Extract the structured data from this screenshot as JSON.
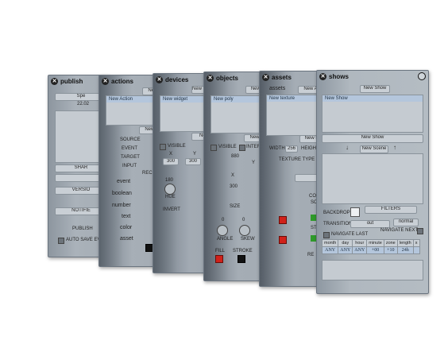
{
  "colors": {
    "accent_red": "#d0211a",
    "accent_green": "#2e9a2a",
    "panel": "#a9b1b9",
    "selection": "#b4c6dc"
  },
  "publish": {
    "title": "publish",
    "top_button": "Spe",
    "field": "22.02",
    "row1": "SHAR",
    "row2": "VERSIO",
    "row3": "NOTIFIE",
    "row4": "PUBLISH",
    "auto_save": "AUTO SAVE EV"
  },
  "actions": {
    "title": "actions",
    "new_button": "New A",
    "selected": "New Action",
    "new_button2": "New A",
    "fields": [
      "SOURCE",
      "EVENT",
      "TARGET",
      "INPUT"
    ],
    "receive": "RECEI",
    "types": [
      "event",
      "boolean",
      "number",
      "text",
      "color",
      "asset"
    ]
  },
  "devices": {
    "title": "devices",
    "new_button": "New Widget",
    "selected": "New widget",
    "new_button2": "New",
    "visible": "VISIBLE",
    "x": "X",
    "y": "Y",
    "val1": "300",
    "val2": "300",
    "hue_val": "180",
    "hue": "HUE",
    "invert": "INVERT"
  },
  "objects": {
    "title": "objects",
    "new_button": "New O",
    "selected": "New poly",
    "new_button2": "New p",
    "visible": "VISIBLE",
    "interact": "INTERA",
    "x_val": "880",
    "y_label": "Y",
    "x": "X",
    "val": "300",
    "size": "SIZE",
    "val0": "0",
    "val1": "0",
    "angle": "ANGLE",
    "skew": "SKEW",
    "fill": "FILL",
    "stroke": "STROKE"
  },
  "assets": {
    "title": "assets",
    "sub": "assets",
    "new_button": "New A",
    "selected": "New texture",
    "new_button2": "New te",
    "width": "WIDTH",
    "width_val": "256",
    "height": "HEIGHT",
    "texture_type": "TEXTURE TYPE",
    "col": "COL",
    "so": "SO",
    "st": "ST",
    "re": "RE"
  },
  "shows": {
    "title": "shows",
    "new_show_button": "New Show",
    "selected": "New Show",
    "new_show_button2": "New Show",
    "new_scene_button": "New Scene",
    "backdrop": "BACKDROP",
    "filters": "FILTERS",
    "transition": "TRANSITION",
    "out": "out",
    "normal": "normal",
    "navigate_last": "NAVIGATE LAST",
    "navigate_next": "NAVIGATE NEXT",
    "table_headers": [
      "month",
      "day",
      "hour",
      "minute",
      "zone",
      "length",
      "x"
    ],
    "table_values": [
      "ANY",
      "ANY",
      "ANY",
      "+00",
      "+10",
      "24h"
    ]
  }
}
